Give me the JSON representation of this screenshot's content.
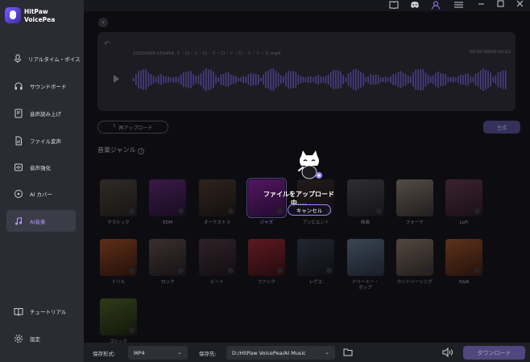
{
  "app": {
    "name_line1": "HitPaw",
    "name_line2": "VoicePea"
  },
  "sidebar": {
    "items": [
      {
        "label": "リアルタイム・ボイス",
        "icon": "microphone-icon"
      },
      {
        "label": "サウンドボード",
        "icon": "headphones-icon"
      },
      {
        "label": "音声読み上げ",
        "icon": "text-to-speech-icon"
      },
      {
        "label": "ファイル変声",
        "icon": "file-icon"
      },
      {
        "label": "音声強化",
        "icon": "enhance-icon"
      },
      {
        "label": "AI カバー",
        "icon": "ai-cover-icon"
      },
      {
        "label": "AI音楽",
        "icon": "ai-music-icon",
        "active": true
      }
    ],
    "tutorial": "チュートリアル",
    "settings": "設定"
  },
  "player": {
    "file_name": "20250305-153454_ミ・ロ・ト・ロ・ミ・ロ・ト・ロ・ミ・ト・ミ.mp4",
    "time": "00:00:00/00:00:22"
  },
  "actions": {
    "reupload": "再アップロード",
    "generate": "生成"
  },
  "genres_title": "音楽ジャンル",
  "genres": [
    {
      "label": "クラシック"
    },
    {
      "label": "EDM"
    },
    {
      "label": "オーケストラ"
    },
    {
      "label": "ジャズ",
      "selected": true
    },
    {
      "label": "アンビエント"
    },
    {
      "label": "映画"
    },
    {
      "label": "フォーク"
    },
    {
      "label": "LoFi"
    },
    {
      "label": "トリル"
    },
    {
      "label": "ロック"
    },
    {
      "label": "ビート"
    },
    {
      "label": "ファンク"
    },
    {
      "label": "レゲエ"
    },
    {
      "label": "ドリーミー・\nポップ"
    },
    {
      "label": "カントリーソング"
    },
    {
      "label": "R&B"
    },
    {
      "label": "ゴシック"
    }
  ],
  "overlay": {
    "status": "ファイルをアップロード中....",
    "cancel": "キャンセル"
  },
  "bottom": {
    "format_label": "保存形式:",
    "format_value": "MP4",
    "dest_label": "保存先:",
    "dest_value": "D:/HitPaw VoicePea/AI Music",
    "download": "ダウンロード"
  },
  "colors": {
    "accent": "#9d86ff",
    "sidebar": "#2a2b33",
    "active_item": "#3b3c48"
  }
}
